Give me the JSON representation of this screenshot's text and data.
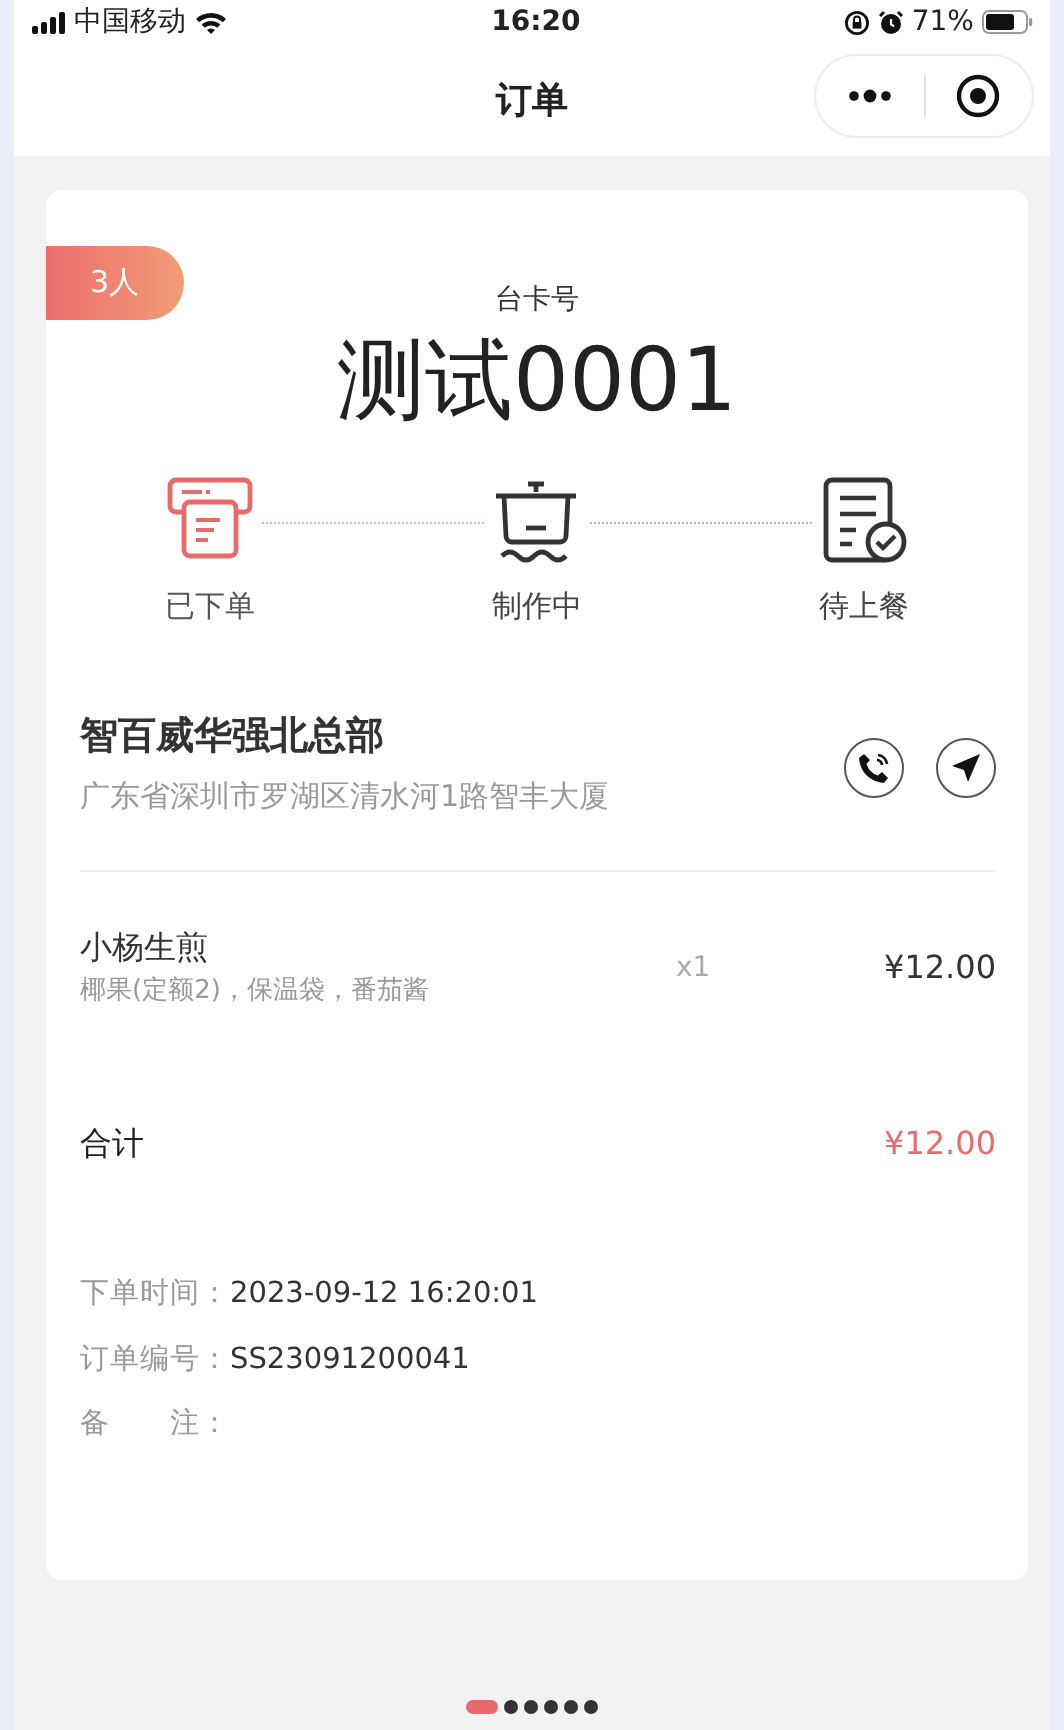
{
  "status_bar": {
    "carrier": "中国移动",
    "time": "16:20",
    "battery": "71%"
  },
  "nav": {
    "title": "订单"
  },
  "ticket": {
    "party_size": "3人",
    "label": "台卡号",
    "number": "测试0001"
  },
  "steps": [
    {
      "kind": "ordered",
      "label": "已下单",
      "done": true
    },
    {
      "kind": "cooking",
      "label": "制作中",
      "done": false
    },
    {
      "kind": "serving",
      "label": "待上餐",
      "done": false
    }
  ],
  "store": {
    "name": "智百威华强北总部",
    "address": "广东省深圳市罗湖区清水河1路智丰大厦"
  },
  "items": [
    {
      "name": "小杨生煎",
      "options": "椰果(定额2)，保温袋，番茄酱",
      "qty": "x1",
      "price": "¥12.00"
    }
  ],
  "total": {
    "label": "合计",
    "amount": "¥12.00"
  },
  "info": [
    {
      "label": "下单时间：",
      "value": "2023-09-12 16:20:01"
    },
    {
      "label": "订单编号：",
      "value": "SS23091200041"
    },
    {
      "label": "备　　注："
    }
  ],
  "pager": [
    {
      "selected": true
    },
    {
      "selected": false
    },
    {
      "selected": false
    },
    {
      "selected": false
    },
    {
      "selected": false
    },
    {
      "selected": false
    }
  ]
}
